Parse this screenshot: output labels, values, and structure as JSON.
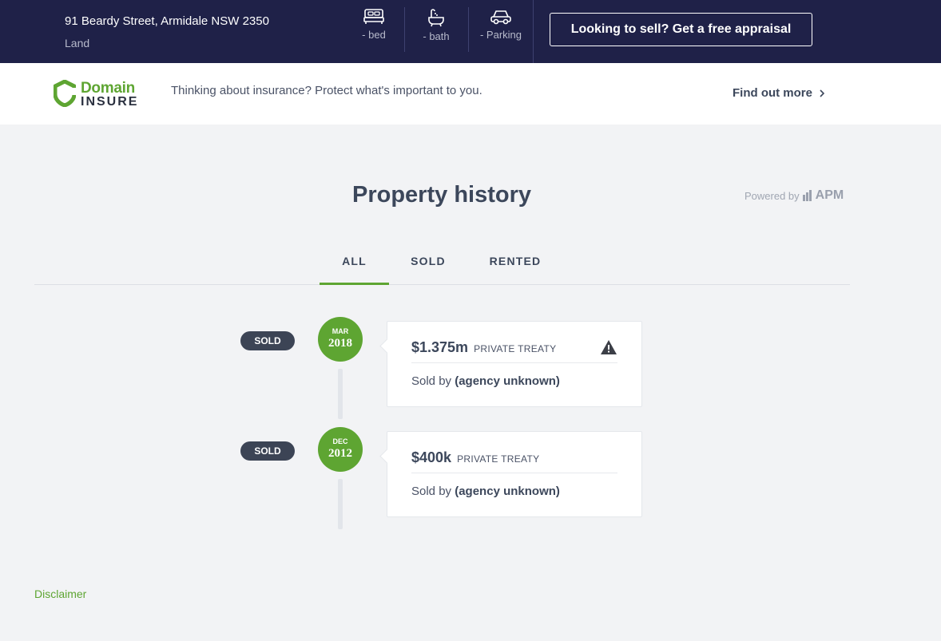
{
  "header": {
    "address": "91 Beardy Street, Armidale NSW 2350",
    "property_type": "Land",
    "features": [
      {
        "icon": "bed-icon",
        "label": "- bed"
      },
      {
        "icon": "bath-icon",
        "label": "- bath"
      },
      {
        "icon": "car-icon",
        "label": "- Parking"
      }
    ],
    "appraisal_label": "Looking to sell? Get a free appraisal"
  },
  "insure": {
    "logo_domain": "Domain",
    "logo_insure": "INSURE",
    "text": "Thinking about insurance? Protect what's important to you.",
    "link_label": "Find out more"
  },
  "history": {
    "title": "Property history",
    "powered_by": "Powered by",
    "powered_brand": "APM",
    "tabs": [
      {
        "label": "ALL",
        "active": true
      },
      {
        "label": "SOLD",
        "active": false
      },
      {
        "label": "RENTED",
        "active": false
      }
    ],
    "events": [
      {
        "status": "SOLD",
        "month": "MAR",
        "year": "2018",
        "price": "$1.375m",
        "method": "PRIVATE TREATY",
        "sold_by_label": "Sold by",
        "agency": "(agency unknown)",
        "warning": true
      },
      {
        "status": "SOLD",
        "month": "DEC",
        "year": "2012",
        "price": "$400k",
        "method": "PRIVATE TREATY",
        "sold_by_label": "Sold by",
        "agency": "(agency unknown)",
        "warning": false
      }
    ]
  },
  "footer": {
    "disclaimer": "Disclaimer"
  },
  "colors": {
    "header_bg": "#1f2148",
    "accent_green": "#5ea532",
    "pill_bg": "#3c4455",
    "page_bg": "#f2f3f5"
  }
}
